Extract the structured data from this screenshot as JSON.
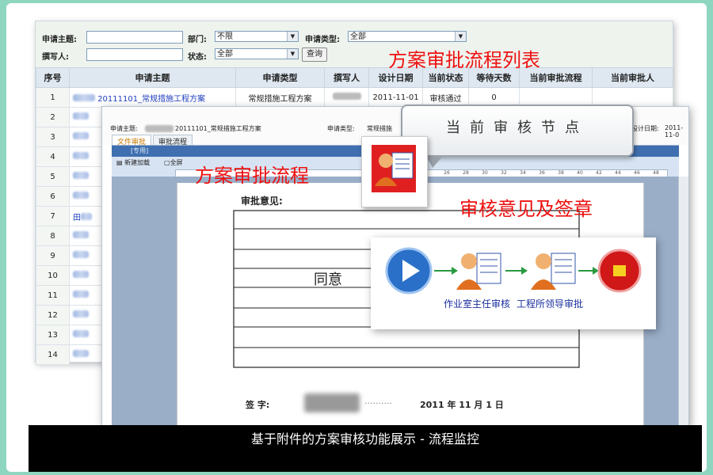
{
  "list_window": {
    "filters": {
      "subject_label": "申请主题:",
      "dept_label": "部门:",
      "dept_value": "不限",
      "type_label": "申请类型:",
      "type_value": "全部",
      "author_label": "撰写人:",
      "status_label": "状态:",
      "status_value": "全部",
      "query_button": "查询"
    },
    "columns": [
      "序号",
      "申请主题",
      "申请类型",
      "撰写人",
      "设计日期",
      "当前状态",
      "等待天数",
      "当前审批流程",
      "当前审批人"
    ],
    "row1": {
      "num": "1",
      "subject": "20111101_常规措施工程方案",
      "type": "常规措施工程方案",
      "date": "2011-11-01",
      "status": "审核通过",
      "days": "0"
    },
    "row_numbers": [
      "2",
      "3",
      "4",
      "5",
      "6",
      "7",
      "8",
      "9",
      "10",
      "11",
      "12",
      "13",
      "14"
    ],
    "row7_prefix": "田"
  },
  "doc_window": {
    "header_subject_label": "申请主题:",
    "header_subject_value": "20111101_常规措施工程方案",
    "header_type_label": "申请类型:",
    "header_type_value": "常规措施",
    "header_date_label": "设计日期:",
    "header_date_value": "2011-11-0",
    "tabs": [
      "文件审批",
      "审批流程"
    ],
    "word_title": "[专用]",
    "tool_new": "新建加载",
    "tool_full": "全屏",
    "ruler_ticks": [
      "26",
      "28",
      "30",
      "32",
      "34",
      "36",
      "38",
      "40",
      "42",
      "44",
      "46",
      "48"
    ],
    "opinion_label": "审批意见:",
    "opinion_text": "同意",
    "sign_label": "签 字:",
    "sign_date": "2011 年 11 月 1 日"
  },
  "annotations": {
    "list_title": "方案审批流程列表",
    "flow_title": "方案审批流程",
    "current_node": "当前审核节点",
    "sign_title": "审核意见及签章"
  },
  "flow": {
    "node1": "作业室主任审核",
    "node2": "工程所领导审批"
  },
  "caption": "基于附件的方案审核功能展示 - 流程监控",
  "colors": {
    "accent_red": "#ee1111",
    "link_blue": "#1f3fbf",
    "bg_teal": "#8fd6c0"
  }
}
